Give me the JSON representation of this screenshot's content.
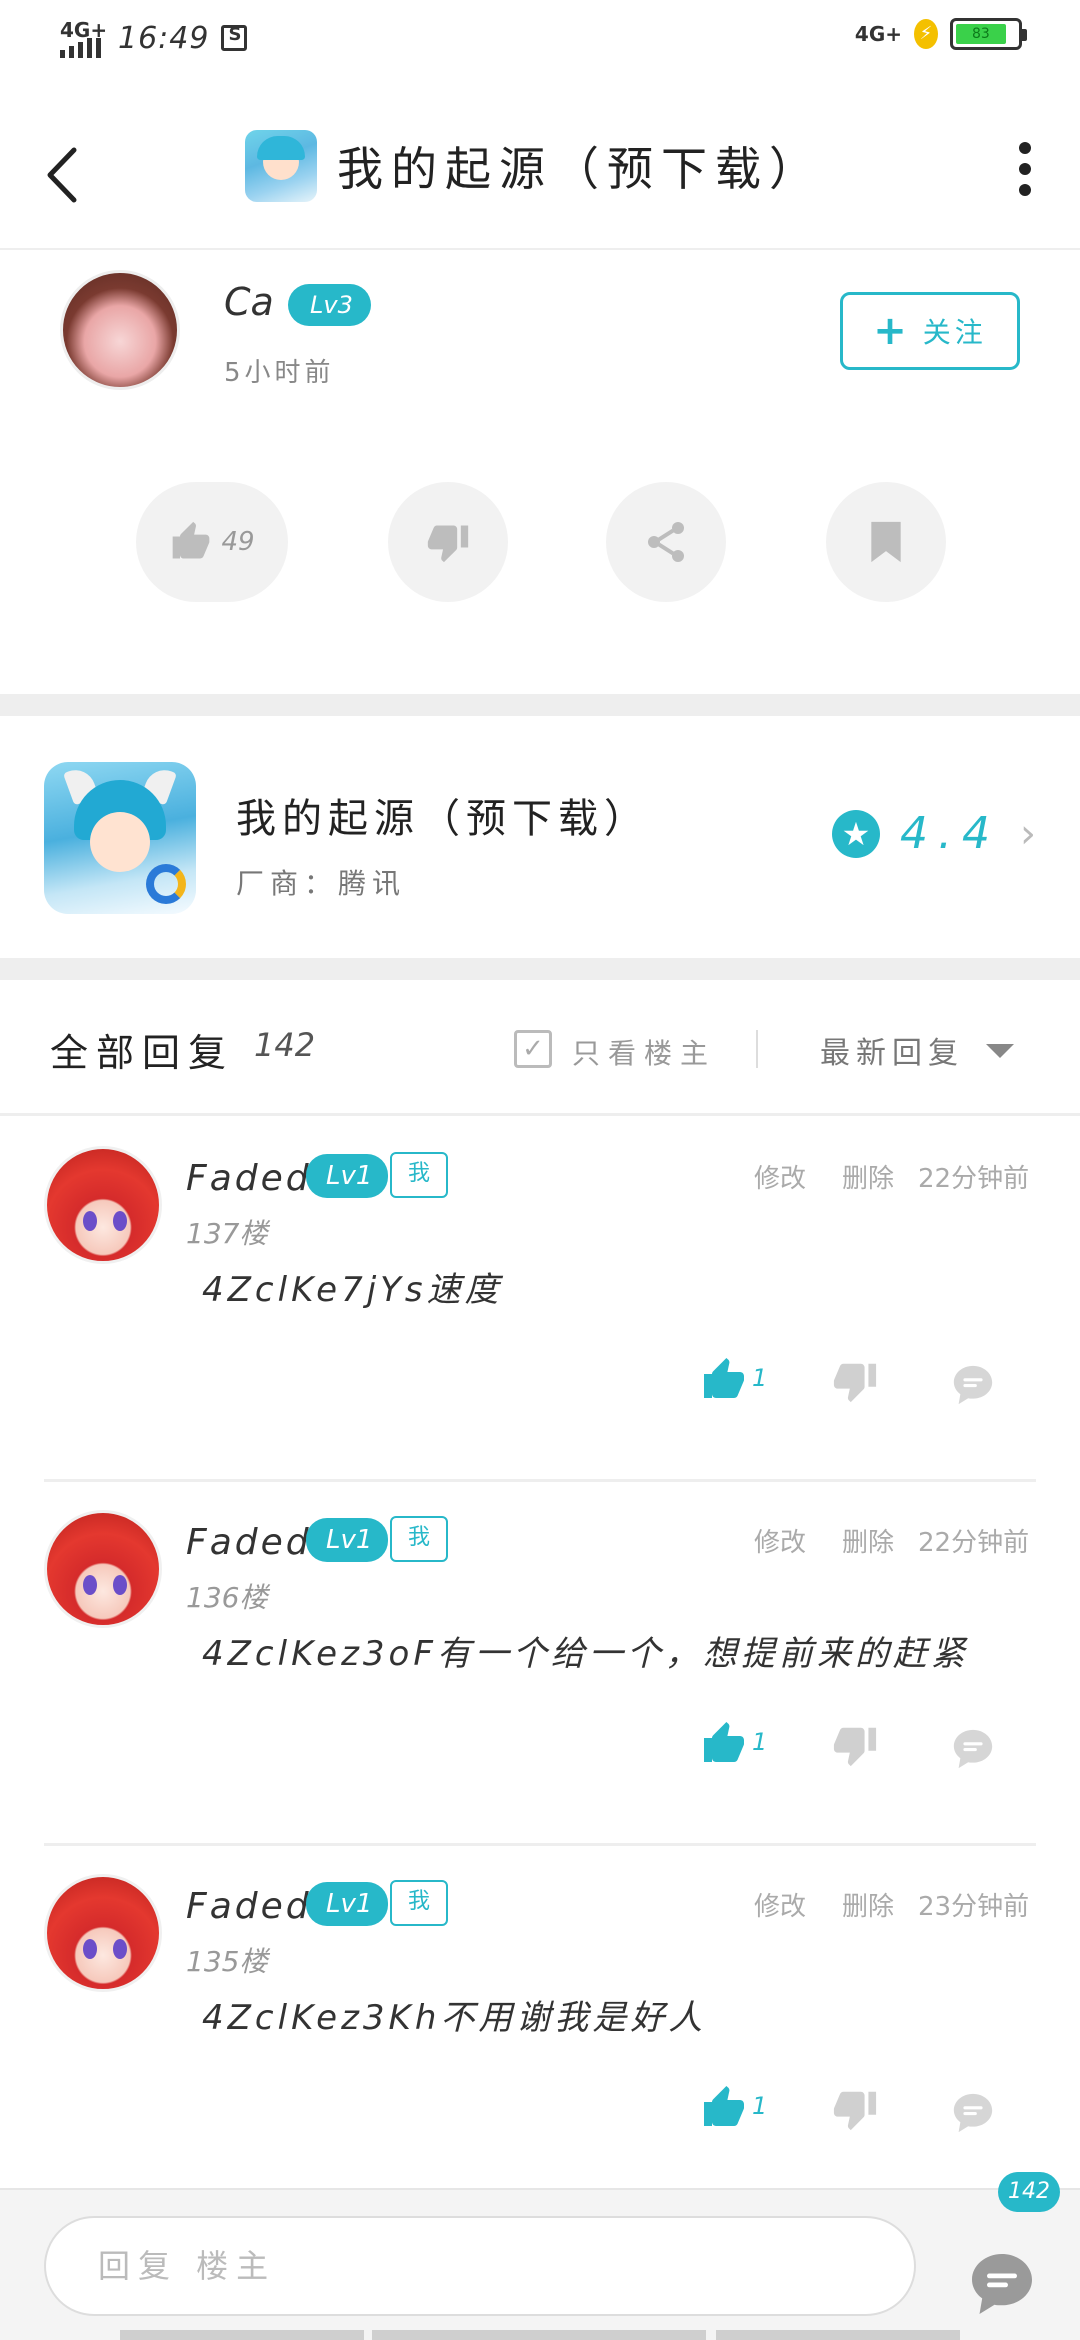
{
  "status_bar": {
    "network_left": "4G+",
    "time": "16:49",
    "network_right": "4G+",
    "battery": "83"
  },
  "header": {
    "title": "我的起源（预下载）"
  },
  "author": {
    "name": "Ca",
    "level": "Lv3",
    "time": "5小时前",
    "follow_label": "关注",
    "likes": "49"
  },
  "game": {
    "name": "我的起源（预下载）",
    "vendor": "厂商：腾讯",
    "rating": "4.4"
  },
  "replies": {
    "title": "全部回复",
    "count": "142",
    "only_owner": "只看楼主",
    "sort": "最新回复"
  },
  "comments": [
    {
      "name": "Faded",
      "level": "Lv1",
      "me": "我",
      "floor": "137楼",
      "edit": "修改",
      "delete": "删除",
      "time": "22分钟前",
      "text": "4ZclKe7jYs速度",
      "likes": "1"
    },
    {
      "name": "Faded",
      "level": "Lv1",
      "me": "我",
      "floor": "136楼",
      "edit": "修改",
      "delete": "删除",
      "time": "22分钟前",
      "text": "4ZclKez3oF有一个给一个，想提前来的赶紧",
      "likes": "1"
    },
    {
      "name": "Faded",
      "level": "Lv1",
      "me": "我",
      "floor": "135楼",
      "edit": "修改",
      "delete": "删除",
      "time": "23分钟前",
      "text": "4ZclKez3Kh不用谢我是好人",
      "likes": "1"
    }
  ],
  "bottom": {
    "placeholder": "回复 楼主",
    "comment_count": "142"
  },
  "colors": {
    "accent": "#27b8c9",
    "separator": "#eeeeee"
  },
  "icons": {
    "back": "chevron-left-icon",
    "more": "vertical-dots-icon",
    "like": "thumbs-up-icon",
    "dislike": "thumbs-down-icon",
    "share": "share-icon",
    "favorite": "bookmark-icon",
    "star": "star-icon",
    "reply": "chat-bubble-icon"
  }
}
